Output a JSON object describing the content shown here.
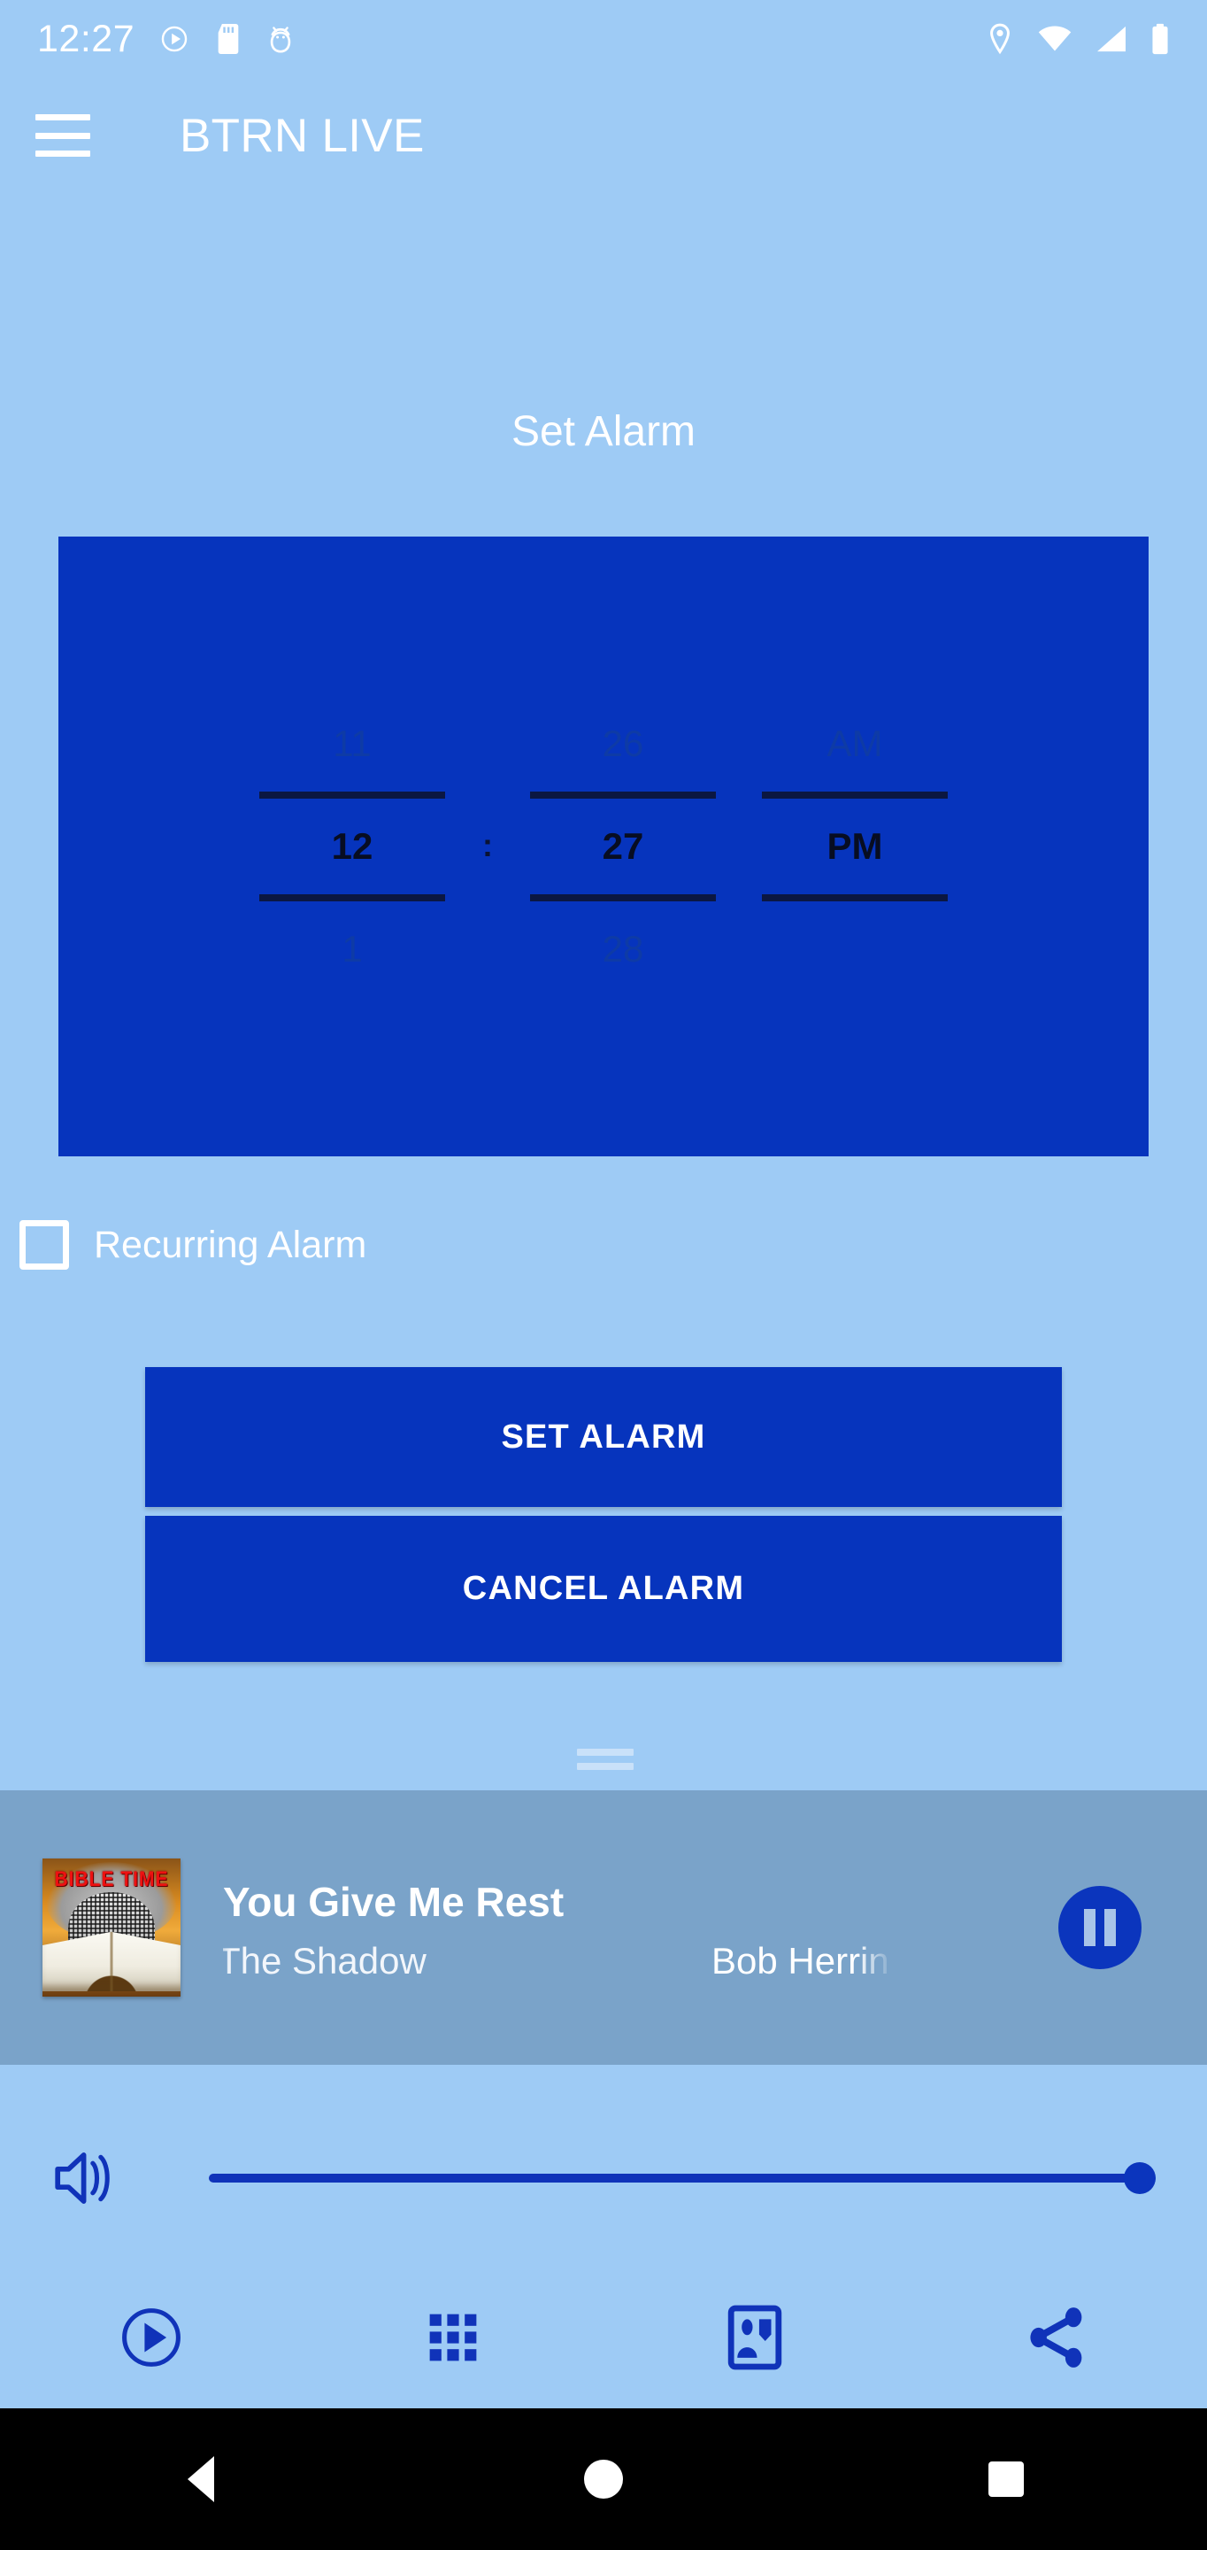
{
  "status_bar": {
    "clock": "12:27",
    "left_icons": [
      "play-circle-icon",
      "sd-card-icon",
      "android-debug-icon"
    ],
    "right_icons": [
      "location-pin-icon",
      "wifi-icon",
      "cell-signal-icon",
      "battery-icon"
    ]
  },
  "app_bar": {
    "menu_icon": "hamburger-menu-icon",
    "title": "BTRN LIVE"
  },
  "alarm": {
    "section_title": "Set Alarm",
    "picker": {
      "hour": {
        "prev": "11",
        "selected": "12",
        "next": "1"
      },
      "separator": ":",
      "minute": {
        "prev": "26",
        "selected": "27",
        "next": "28"
      },
      "meridiem": {
        "prev": "AM",
        "selected": "PM",
        "next": ""
      }
    },
    "recurring_label": "Recurring Alarm",
    "recurring_checked": false,
    "set_button_label": "SET ALARM",
    "cancel_button_label": "CANCEL ALARM"
  },
  "now_playing": {
    "album_art_text": "BIBLE TIME",
    "title": "You Give Me Rest",
    "show": "The Shadow",
    "host": "Bob Herrin",
    "transport_icon": "pause-icon",
    "transport_state": "playing"
  },
  "volume": {
    "icon": "volume-up-icon",
    "level_percent": 100
  },
  "bottom_nav": [
    {
      "name": "play-circle-icon",
      "label": "Play"
    },
    {
      "name": "grid-apps-icon",
      "label": "Apps"
    },
    {
      "name": "contact-card-icon",
      "label": "Contact"
    },
    {
      "name": "share-icon",
      "label": "Share"
    }
  ],
  "android_nav": {
    "back": "back-triangle-icon",
    "home": "home-circle-icon",
    "recents": "recents-square-icon"
  },
  "colors": {
    "page_background": "#9ecbf5",
    "primary_blue": "#0634bd",
    "picker_divider": "#0b1742",
    "player_background": "#7aa3c9",
    "on_primary": "#ffffff"
  }
}
